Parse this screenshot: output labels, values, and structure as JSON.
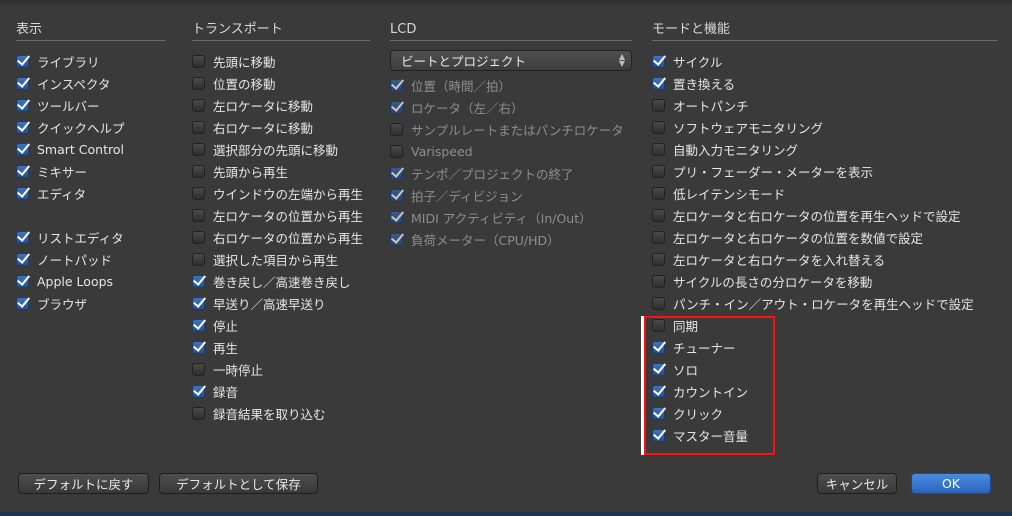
{
  "view": {
    "heading": "表示",
    "items": [
      {
        "label": "ライブラリ",
        "checked": true
      },
      {
        "label": "インスペクタ",
        "checked": true
      },
      {
        "label": "ツールバー",
        "checked": true
      },
      {
        "label": "クイックヘルプ",
        "checked": true
      },
      {
        "label": "Smart Control",
        "checked": true
      },
      {
        "label": "ミキサー",
        "checked": true
      },
      {
        "label": "エディタ",
        "checked": true
      },
      null,
      {
        "label": "リストエディタ",
        "checked": true
      },
      {
        "label": "ノートパッド",
        "checked": true
      },
      {
        "label": "Apple Loops",
        "checked": true
      },
      {
        "label": "ブラウザ",
        "checked": true
      }
    ]
  },
  "transport": {
    "heading": "トランスポート",
    "items": [
      {
        "label": "先頭に移動",
        "checked": false
      },
      {
        "label": "位置の移動",
        "checked": false
      },
      {
        "label": "左ロケータに移動",
        "checked": false
      },
      {
        "label": "右ロケータに移動",
        "checked": false
      },
      {
        "label": "選択部分の先頭に移動",
        "checked": false
      },
      {
        "label": "先頭から再生",
        "checked": false
      },
      {
        "label": "ウインドウの左端から再生",
        "checked": false
      },
      {
        "label": "左ロケータの位置から再生",
        "checked": false
      },
      {
        "label": "右ロケータの位置から再生",
        "checked": false
      },
      {
        "label": "選択した項目から再生",
        "checked": false
      },
      {
        "label": "巻き戻し／高速巻き戻し",
        "checked": true
      },
      {
        "label": "早送り／高速早送り",
        "checked": true
      },
      {
        "label": "停止",
        "checked": true
      },
      {
        "label": "再生",
        "checked": true
      },
      {
        "label": "一時停止",
        "checked": false
      },
      {
        "label": "録音",
        "checked": true
      },
      {
        "label": "録音結果を取り込む",
        "checked": false
      }
    ]
  },
  "lcd": {
    "heading": "LCD",
    "select_value": "ビートとプロジェクト",
    "items": [
      {
        "label": "位置（時間／拍）",
        "checked": true
      },
      {
        "label": "ロケータ（左／右）",
        "checked": true
      },
      {
        "label": "サンプルレートまたはパンチロケータ",
        "checked": false
      },
      {
        "label": "Varispeed",
        "checked": false
      },
      {
        "label": "テンポ／プロジェクトの終了",
        "checked": true
      },
      {
        "label": "拍子／ディビジョン",
        "checked": true
      },
      {
        "label": "MIDI アクティビティ（In/Out）",
        "checked": true
      },
      {
        "label": "負荷メーター（CPU/HD）",
        "checked": true
      }
    ]
  },
  "modes": {
    "heading": "モードと機能",
    "items": [
      {
        "label": "サイクル",
        "checked": true
      },
      {
        "label": "置き換える",
        "checked": true
      },
      {
        "label": "オートパンチ",
        "checked": false
      },
      {
        "label": "ソフトウェアモニタリング",
        "checked": false
      },
      {
        "label": "自動入力モニタリング",
        "checked": false
      },
      {
        "label": "プリ・フェーダー・メーターを表示",
        "checked": false
      },
      {
        "label": "低レイテンシモード",
        "checked": false
      },
      {
        "label": "左ロケータと右ロケータの位置を再生ヘッドで設定",
        "checked": false
      },
      {
        "label": "左ロケータと右ロケータの位置を数値で設定",
        "checked": false
      },
      {
        "label": "左ロケータと右ロケータを入れ替える",
        "checked": false
      },
      {
        "label": "サイクルの長さの分ロケータを移動",
        "checked": false
      },
      {
        "label": "パンチ・イン／アウト・ロケータを再生ヘッドで設定",
        "checked": false
      },
      {
        "label": "同期",
        "checked": false
      },
      {
        "label": "チューナー",
        "checked": true
      },
      {
        "label": "ソロ",
        "checked": true
      },
      {
        "label": "カウントイン",
        "checked": true
      },
      {
        "label": "クリック",
        "checked": true
      },
      {
        "label": "マスター音量",
        "checked": true
      }
    ]
  },
  "buttons": {
    "revert_default": "デフォルトに戻す",
    "save_default": "デフォルトとして保存",
    "cancel": "キャンセル",
    "ok": "OK"
  },
  "colors": {
    "accent": "#2a64bc",
    "annotation": "#ff1010"
  }
}
